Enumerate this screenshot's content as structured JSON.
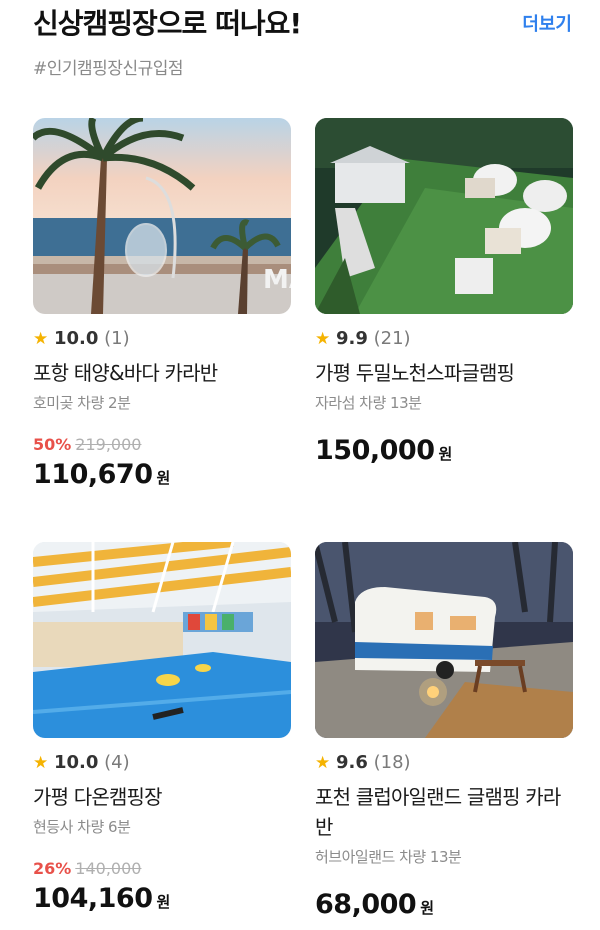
{
  "header": {
    "title": "신상캠핑장으로 떠나요!",
    "more_label": "더보기",
    "subtitle": "#인기캠핑장신규입점"
  },
  "rating_icon": "star-icon",
  "colors": {
    "accent": "#2f80ed",
    "discount": "#e8514a",
    "star": "#f5b301"
  },
  "listings": [
    {
      "score": "10.0",
      "reviews": "(1)",
      "name": "포항 태양&바다 카라반",
      "location": "호미곶 차량 2분",
      "discount_pct": "50%",
      "original_price": "219,000",
      "price": "110,670",
      "currency": "원",
      "image_sign": "MAVA"
    },
    {
      "score": "9.9",
      "reviews": "(21)",
      "name": "가평 두밀노천스파글램핑",
      "location": "자라섬 차량 13분",
      "discount_pct": "",
      "original_price": "",
      "price": "150,000",
      "currency": "원"
    },
    {
      "score": "10.0",
      "reviews": "(4)",
      "name": "가평 다온캠핑장",
      "location": "현등사 차량 6분",
      "discount_pct": "26%",
      "original_price": "140,000",
      "price": "104,160",
      "currency": "원"
    },
    {
      "score": "9.6",
      "reviews": "(18)",
      "name": "포천 클럽아일랜드 글램핑 카라반",
      "location": "허브아일랜드 차량 13분",
      "discount_pct": "",
      "original_price": "",
      "price": "68,000",
      "currency": "원"
    }
  ]
}
